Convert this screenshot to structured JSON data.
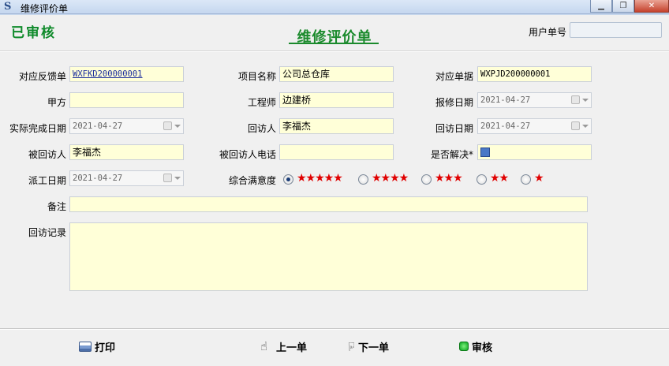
{
  "window": {
    "title": "维修评价单",
    "app_icon": "S",
    "minimize": "▁",
    "restore": "❐",
    "close": "✕"
  },
  "header": {
    "status_stamp": "已审核",
    "form_title": "维修评价单",
    "userno_label": "用户单号",
    "userno_value": ""
  },
  "fields": {
    "feedback_no_label": "对应反馈单",
    "feedback_no_value": "WXFKD200000001",
    "project_label": "项目名称",
    "project_value": "公司总仓库",
    "doc_label": "对应单据",
    "doc_value": "WXPJD200000001",
    "party_a_label": "甲方",
    "party_a_value": "",
    "engineer_label": "工程师",
    "engineer_value": "边建桥",
    "report_date_label": "报修日期",
    "report_date_value": "2021-04-27",
    "finish_date_label": "实际完成日期",
    "finish_date_value": "2021-04-27",
    "visitor_label": "回访人",
    "visitor_value": "李福杰",
    "visit_date_label": "回访日期",
    "visit_date_value": "2021-04-27",
    "visitee_label": "被回访人",
    "visitee_value": "李福杰",
    "visitee_phone_label": "被回访人电话",
    "visitee_phone_value": "",
    "resolved_label": "是否解决*",
    "dispatch_date_label": "派工日期",
    "dispatch_date_value": "2021-04-27",
    "satisfaction_label": "综合满意度",
    "remark_label": "备注",
    "remark_value": "",
    "visit_record_label": "回访记录",
    "visit_record_value": ""
  },
  "satisfaction": {
    "options": [
      {
        "stars": "★★★★★",
        "checked": true
      },
      {
        "stars": "★★★★",
        "checked": false
      },
      {
        "stars": "★★★",
        "checked": false
      },
      {
        "stars": "★★",
        "checked": false
      },
      {
        "stars": "★",
        "checked": false
      }
    ]
  },
  "actions": {
    "print": "打印",
    "prev": "上一单",
    "next": "下一单",
    "approve": "审核"
  },
  "colors": {
    "accent_green": "#1a8a2c",
    "field_bg": "#ffffd8",
    "star_red": "#e00000"
  }
}
